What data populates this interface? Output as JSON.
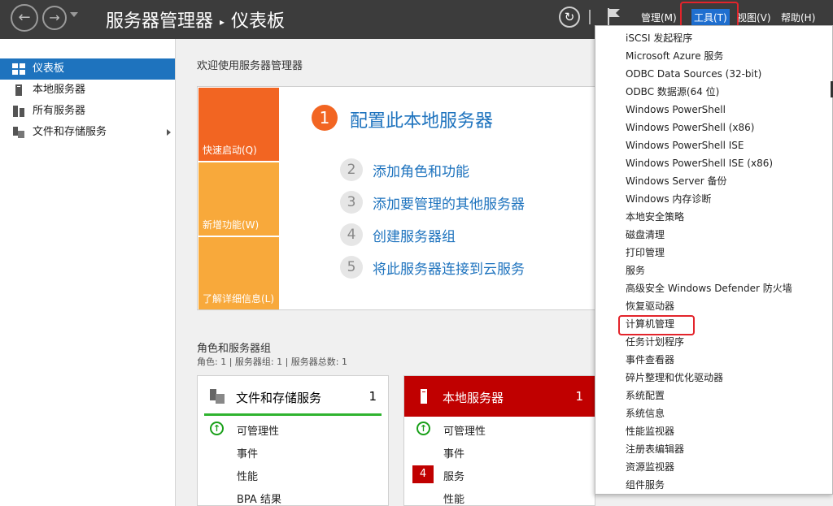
{
  "titlebar": {
    "app": "服务器管理器",
    "page": "仪表板",
    "menus": {
      "manage": "管理(M)",
      "tools": "工具(T)",
      "view": "视图(V)",
      "help": "帮助(H)"
    }
  },
  "sidebar": {
    "items": [
      {
        "label": "仪表板"
      },
      {
        "label": "本地服务器"
      },
      {
        "label": "所有服务器"
      },
      {
        "label": "文件和存储服务"
      }
    ]
  },
  "welcome": {
    "title": "欢迎使用服务器管理器",
    "tiles": [
      "快速启动(Q)",
      "新增功能(W)",
      "了解详细信息(L)"
    ],
    "steps": [
      {
        "num": "1",
        "label": "配置此本地服务器"
      },
      {
        "num": "2",
        "label": "添加角色和功能"
      },
      {
        "num": "3",
        "label": "添加要管理的其他服务器"
      },
      {
        "num": "4",
        "label": "创建服务器组"
      },
      {
        "num": "5",
        "label": "将此服务器连接到云服务"
      }
    ]
  },
  "roles": {
    "title": "角色和服务器组",
    "summary": "角色: 1 | 服务器组: 1 | 服务器总数: 1",
    "cards": [
      {
        "title": "文件和存储服务",
        "count": "1",
        "rows": [
          "可管理性",
          "事件",
          "性能",
          "BPA 结果"
        ]
      },
      {
        "title": "本地服务器",
        "count": "1",
        "badge": "4",
        "rows": [
          "可管理性",
          "事件",
          "服务",
          "性能"
        ]
      }
    ]
  },
  "tools_menu": {
    "items": [
      "iSCSI 发起程序",
      "Microsoft Azure 服务",
      "ODBC Data Sources (32-bit)",
      "ODBC 数据源(64 位)",
      "Windows PowerShell",
      "Windows PowerShell (x86)",
      "Windows PowerShell ISE",
      "Windows PowerShell ISE (x86)",
      "Windows Server 备份",
      "Windows 内存诊断",
      "本地安全策略",
      "磁盘清理",
      "打印管理",
      "服务",
      "高级安全 Windows Defender 防火墙",
      "恢复驱动器",
      "计算机管理",
      "任务计划程序",
      "事件查看器",
      "碎片整理和优化驱动器",
      "系统配置",
      "系统信息",
      "性能监视器",
      "注册表编辑器",
      "资源监视器",
      "组件服务"
    ]
  },
  "colors": {
    "accent": "#1e73be",
    "quickstart": "#f26522",
    "tile": "#f8a93b",
    "alert": "#c00000",
    "ok": "#2fb32f",
    "highlight": "#e3242b"
  },
  "icons": [
    "back-arrow-icon",
    "forward-arrow-icon",
    "refresh-icon",
    "flag-icon",
    "dashboard-icon",
    "server-icon",
    "servers-icon",
    "storage-icon",
    "up-arrow-icon"
  ]
}
